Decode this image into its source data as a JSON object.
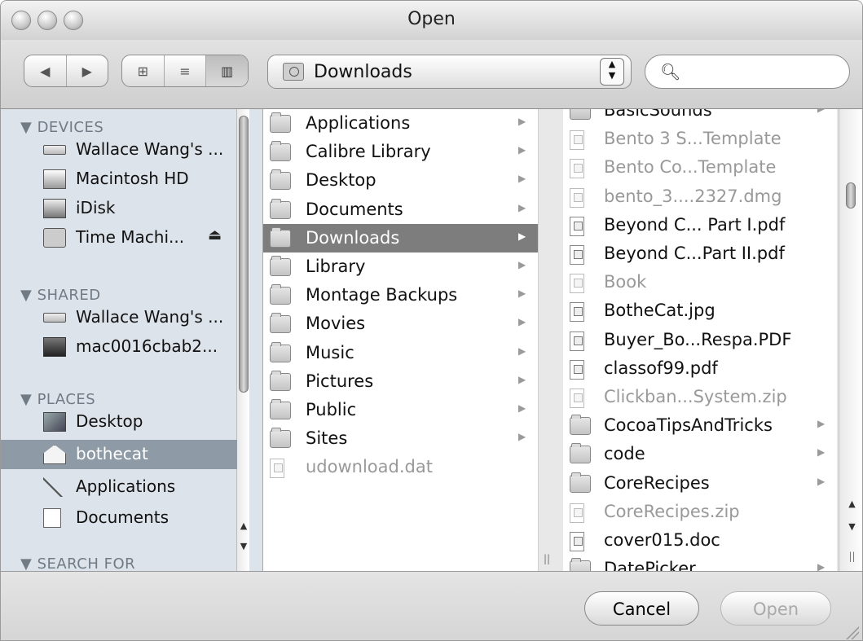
{
  "window": {
    "title": "Open"
  },
  "toolbar": {
    "back_glyph": "◀",
    "forward_glyph": "▶",
    "view_icon_glyph": "⊞",
    "view_list_glyph": "≡",
    "view_column_glyph": "▥",
    "location": "Downloads",
    "search": {
      "value": "",
      "placeholder": ""
    }
  },
  "sidebar": {
    "sections": [
      {
        "heading": "▼ DEVICES",
        "items": [
          {
            "label": "Wallace Wang's ...",
            "icon": "drive-icon"
          },
          {
            "label": "Macintosh HD",
            "icon": "harddisk-icon"
          },
          {
            "label": "iDisk",
            "icon": "idisk-icon"
          },
          {
            "label": "Time Machi...",
            "icon": "time-machine-icon",
            "eject": "⏏"
          }
        ]
      },
      {
        "heading": "▼ SHARED",
        "items": [
          {
            "label": "Wallace Wang's ...",
            "icon": "drive-icon"
          },
          {
            "label": "mac0016cbab2...",
            "icon": "computer-icon"
          }
        ]
      },
      {
        "heading": "▼ PLACES",
        "items": [
          {
            "label": "Desktop",
            "icon": "desktop-icon"
          },
          {
            "label": "bothecat",
            "icon": "home-icon",
            "selected": true
          },
          {
            "label": "Applications",
            "icon": "applications-icon"
          },
          {
            "label": "Documents",
            "icon": "documents-icon"
          }
        ]
      },
      {
        "heading": "▼ SEARCH FOR"
      }
    ]
  },
  "columns": {
    "col1": [
      {
        "label": "Applications",
        "kind": "folder",
        "arrow": "▶"
      },
      {
        "label": "Calibre Library",
        "kind": "folder",
        "arrow": "▶"
      },
      {
        "label": "Desktop",
        "kind": "folder",
        "arrow": "▶"
      },
      {
        "label": "Documents",
        "kind": "folder",
        "arrow": "▶"
      },
      {
        "label": "Downloads",
        "kind": "folder",
        "arrow": "▶",
        "selected": true
      },
      {
        "label": "Library",
        "kind": "folder",
        "arrow": "▶"
      },
      {
        "label": "Montage Backups",
        "kind": "folder",
        "arrow": "▶"
      },
      {
        "label": "Movies",
        "kind": "folder",
        "arrow": "▶"
      },
      {
        "label": "Music",
        "kind": "folder",
        "arrow": "▶"
      },
      {
        "label": "Pictures",
        "kind": "folder",
        "arrow": "▶"
      },
      {
        "label": "Public",
        "kind": "folder",
        "arrow": "▶"
      },
      {
        "label": "Sites",
        "kind": "folder",
        "arrow": "▶"
      },
      {
        "label": "udownload.dat",
        "kind": "file",
        "dim": true
      }
    ],
    "col2": [
      {
        "label": "BasicSounds",
        "kind": "folder",
        "arrow": "▶"
      },
      {
        "label": "Bento 3 S...Template",
        "kind": "file",
        "dim": true
      },
      {
        "label": "Bento Co...Template",
        "kind": "file",
        "dim": true
      },
      {
        "label": "bento_3....2327.dmg",
        "kind": "file",
        "dim": true
      },
      {
        "label": "Beyond C... Part I.pdf",
        "kind": "file"
      },
      {
        "label": "Beyond C...Part II.pdf",
        "kind": "file"
      },
      {
        "label": "Book",
        "kind": "file",
        "dim": true
      },
      {
        "label": "BotheCat.jpg",
        "kind": "file"
      },
      {
        "label": "Buyer_Bo...Respa.PDF",
        "kind": "file"
      },
      {
        "label": "classof99.pdf",
        "kind": "file"
      },
      {
        "label": "Clickban...System.zip",
        "kind": "file",
        "dim": true
      },
      {
        "label": "CocoaTipsAndTricks",
        "kind": "folder",
        "arrow": "▶"
      },
      {
        "label": "code",
        "kind": "folder",
        "arrow": "▶"
      },
      {
        "label": "CoreRecipes",
        "kind": "folder",
        "arrow": "▶"
      },
      {
        "label": "CoreRecipes.zip",
        "kind": "file",
        "dim": true
      },
      {
        "label": "cover015.doc",
        "kind": "file"
      },
      {
        "label": "DatePicker",
        "kind": "folder",
        "arrow": "▶"
      }
    ]
  },
  "buttons": {
    "cancel": "Cancel",
    "open": "Open"
  },
  "colors": {
    "sidebar_bg": "#dde3ea",
    "selection_gray": "#7d7d7d"
  }
}
